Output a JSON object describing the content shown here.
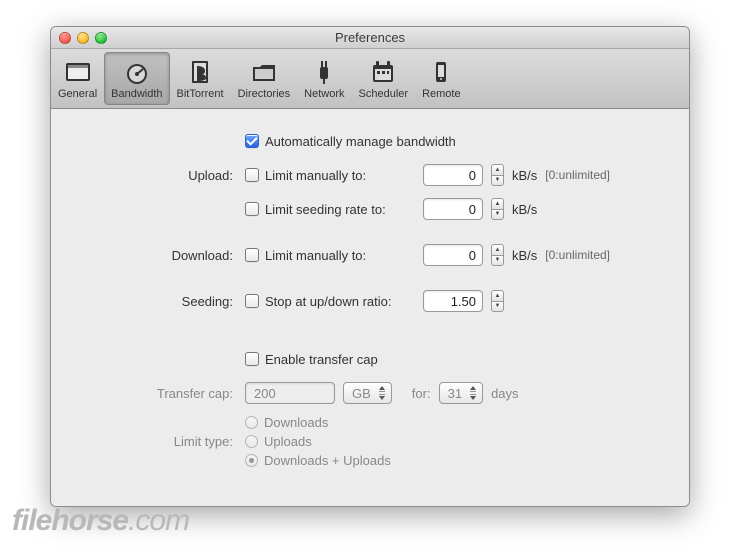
{
  "window": {
    "title": "Preferences"
  },
  "tabs": [
    {
      "label": "General"
    },
    {
      "label": "Bandwidth"
    },
    {
      "label": "BitTorrent"
    },
    {
      "label": "Directories"
    },
    {
      "label": "Network"
    },
    {
      "label": "Scheduler"
    },
    {
      "label": "Remote"
    }
  ],
  "form": {
    "auto_manage_label": "Automatically manage bandwidth",
    "auto_manage_checked": true,
    "upload_label": "Upload:",
    "upload_limit_label": "Limit manually to:",
    "upload_limit_value": "0",
    "upload_seed_label": "Limit seeding rate to:",
    "upload_seed_value": "0",
    "download_label": "Download:",
    "download_limit_label": "Limit manually to:",
    "download_limit_value": "0",
    "seeding_label": "Seeding:",
    "seeding_stop_label": "Stop at up/down ratio:",
    "seeding_stop_value": "1.50",
    "unit": "kB/s",
    "hint_unlimited": "[0:unlimited]",
    "enable_cap_label": "Enable transfer cap",
    "cap_label": "Transfer cap:",
    "cap_value": "200",
    "cap_unit": "GB",
    "cap_for": "for:",
    "cap_days_value": "31",
    "cap_days_label": "days",
    "limit_type_label": "Limit type:",
    "limit_type_options": [
      "Downloads",
      "Uploads",
      "Downloads + Uploads"
    ],
    "limit_type_selected": 2
  },
  "watermark": {
    "a": "filehorse",
    "b": ".com"
  }
}
